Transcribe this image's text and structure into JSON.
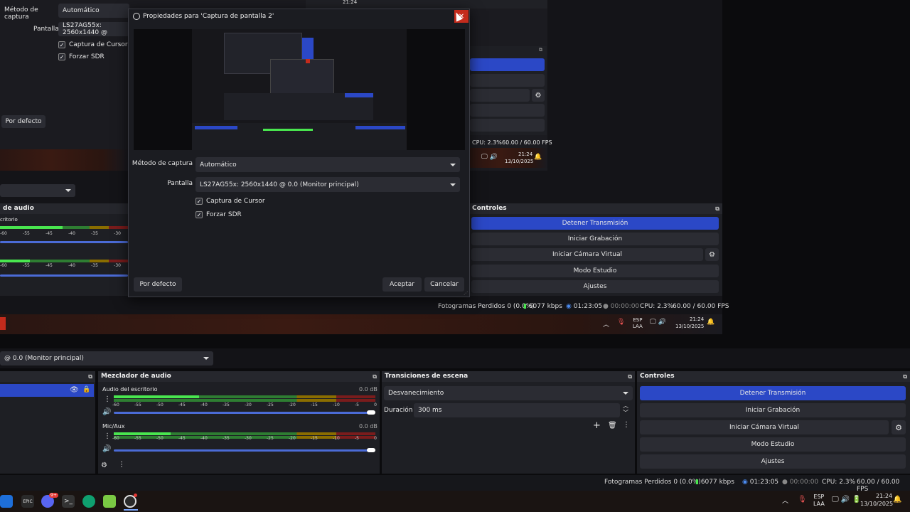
{
  "bg_top_left": {
    "capture_method_label": "Método de captura",
    "capture_method_value": "Automático",
    "screen_label": "Pantalla",
    "screen_value": "LS27AG55x: 2560x1440 @",
    "cursor_capture": "Captura de Cursor",
    "force_sdr": "Forzar SDR",
    "defaults_button": "Por defecto"
  },
  "bg_mirror": {
    "audio_head": "de audio",
    "desktop_label": "critorio",
    "controls_head": "Controles",
    "stop_stream": "Detener Transmisión",
    "start_record": "Iniciar Grabación",
    "start_vcam": "Iniciar Cámara Virtual",
    "studio_mode": "Modo Estudio",
    "settings": "Ajustes",
    "status_dropped": "Fotogramas Perdidos 0 (0.0%)",
    "status_kbps": "6077 kbps",
    "status_time": "01:23:05",
    "status_rec": "00:00:00",
    "status_cpu": "CPU: 2.3%",
    "status_fps": "60.00 / 60.00 FPS",
    "tray_lang": "ESP",
    "tray_layout": "LAA",
    "tray_time": "21:24",
    "tray_date": "13/10/2025",
    "small_cpu": "CPU: 2.3%",
    "small_fps": "60.00 / 60.00 FPS",
    "small_time": "21:24",
    "small_date": "13/10/2025",
    "meter_scale": [
      "-60",
      "-55",
      "-45",
      "-40",
      "-35",
      "-30",
      "-25"
    ]
  },
  "main": {
    "source_dropdown": "@ 0.0 (Monitor principal)",
    "mixer_head": "Mezclador de audio",
    "transitions_head": "Transiciones de escena",
    "controls_head": "Controles",
    "desktop_audio": "Audio del escritorio",
    "desktop_db": "0.0 dB",
    "mic_audio": "Mic/Aux",
    "mic_db": "0.0 dB",
    "meter_scale": [
      "-60",
      "-55",
      "-50",
      "-45",
      "-40",
      "-35",
      "-30",
      "-25",
      "-20",
      "-15",
      "-10",
      "-5",
      "0"
    ],
    "transition_value": "Desvanecimiento",
    "duration_label": "Duración",
    "duration_value": "300 ms",
    "stop_stream": "Detener Transmisión",
    "start_record": "Iniciar Grabación",
    "start_vcam": "Iniciar Cámara Virtual",
    "studio_mode": "Modo Estudio",
    "settings": "Ajustes",
    "status_dropped": "Fotogramas Perdidos 0 (0.0%)",
    "status_kbps": "6077 kbps",
    "status_time": "01:23:05",
    "status_rec": "00:00:00",
    "status_cpu": "CPU: 2.3%",
    "status_fps": "60.00 / 60.00 FPS"
  },
  "taskbar": {
    "lang": "ESP",
    "layout": "LAA",
    "time": "21:24",
    "date": "13/10/2025",
    "discord_badge": "9+",
    "epic_label": "EPIC"
  },
  "dialog": {
    "title": "Propiedades para 'Captura de pantalla 2'",
    "capture_method_label": "Método de captura",
    "capture_method_value": "Automático",
    "screen_label": "Pantalla",
    "screen_value": "LS27AG55x: 2560x1440 @ 0.0 (Monitor principal)",
    "cursor_capture": "Captura de Cursor",
    "force_sdr": "Forzar SDR",
    "defaults_button": "Por defecto",
    "accept_button": "Aceptar",
    "cancel_button": "Cancelar",
    "close_glyph": "✕"
  },
  "colors": {
    "accent": "#2b48c6",
    "close_red": "#c42b1c",
    "meter_green": "#49e64f"
  }
}
